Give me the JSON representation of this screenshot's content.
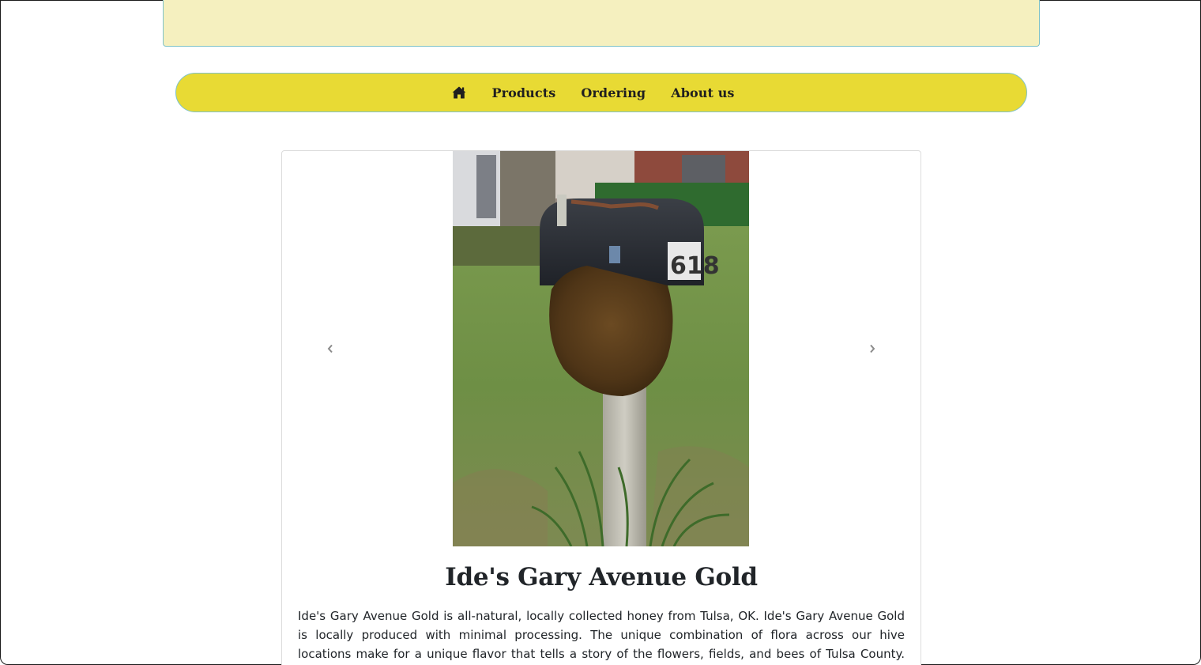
{
  "nav": {
    "home_icon": "home-icon",
    "items": [
      {
        "label": "Products"
      },
      {
        "label": "Ordering"
      },
      {
        "label": "About us"
      }
    ]
  },
  "carousel": {
    "image_alt": "Bee swarm on a mailbox numbered 618",
    "prev_icon": "chevron-left-icon",
    "next_icon": "chevron-right-icon"
  },
  "product": {
    "title": "Ide's Gary Avenue Gold",
    "description": "Ide's Gary Avenue Gold is all-natural, locally collected honey from Tulsa, OK. Ide's Gary Avenue Gold is locally produced with minimal processing. The unique combination of flora across our hive locations make for a unique flavor that tells a story of the flowers, fields, and bees of Tulsa County. We're"
  },
  "colors": {
    "banner": "#f5f0bf",
    "navbar": "#e8da34",
    "accent_border": "#7fc2c9"
  }
}
